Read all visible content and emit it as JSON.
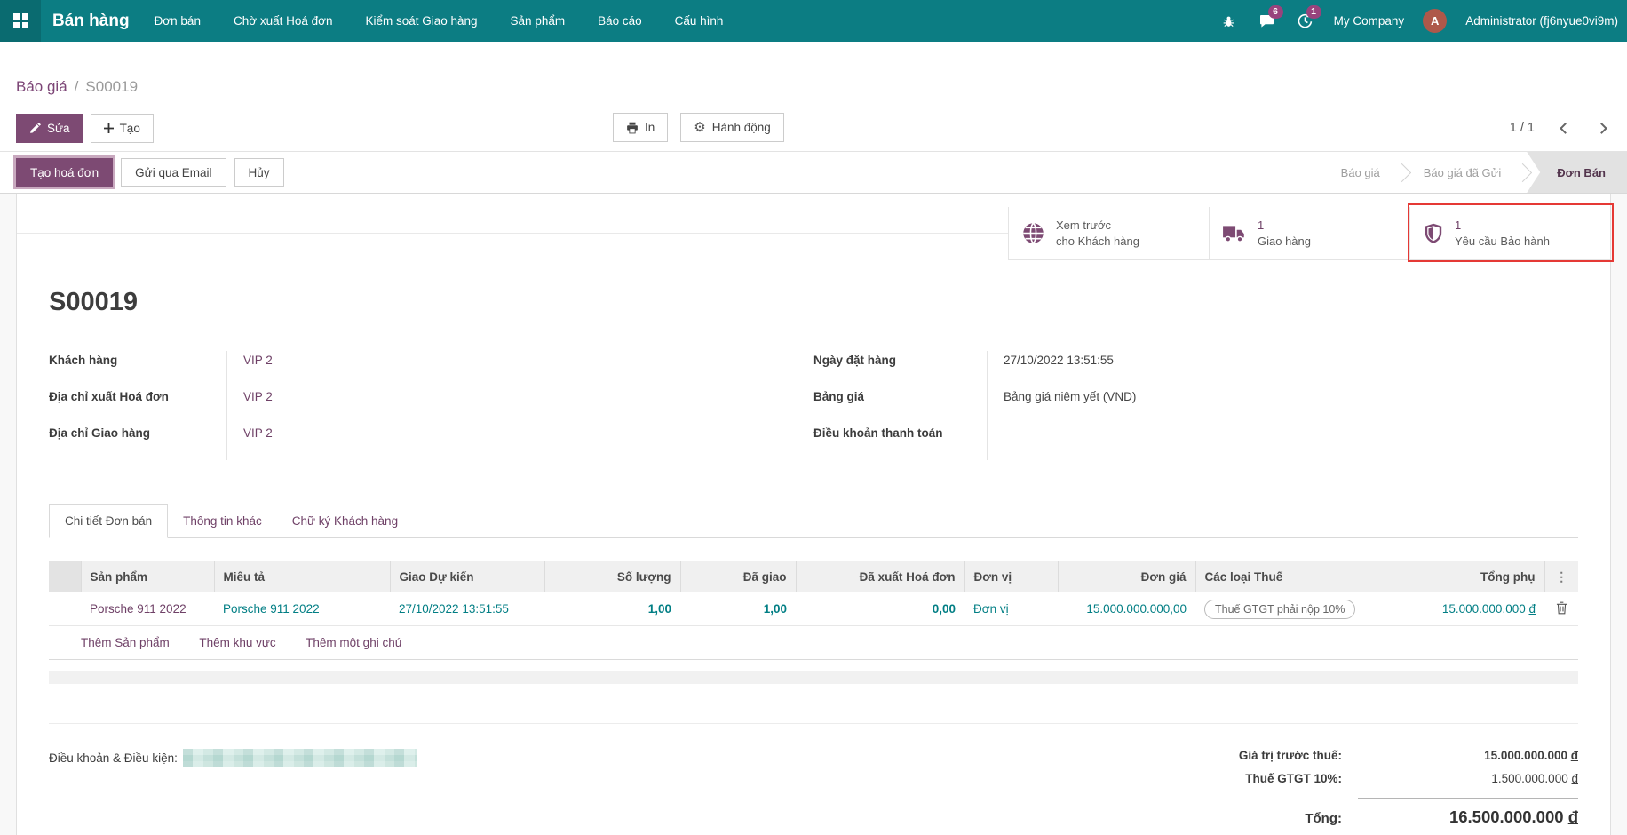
{
  "navbar": {
    "app_name": "Bán hàng",
    "menu_items": [
      "Đơn bán",
      "Chờ xuất Hoá đơn",
      "Kiểm soát Giao hàng",
      "Sản phẩm",
      "Báo cáo",
      "Cấu hình"
    ],
    "badges": {
      "messages": "6",
      "activities": "1"
    },
    "company": "My Company",
    "avatar_letter": "A",
    "user_name": "Administrator (fj6nyue0vi9m)"
  },
  "breadcrumb": {
    "parent": "Báo giá",
    "separator": "/",
    "current": "S00019"
  },
  "control_panel": {
    "edit_label": "Sửa",
    "create_label": "Tạo",
    "print_label": "In",
    "action_label": "Hành động",
    "pager_text": "1 / 1"
  },
  "statusbar": {
    "buttons": [
      "Tạo hoá đơn",
      "Gửi qua Email",
      "Hủy"
    ],
    "stages": [
      {
        "label": "Báo giá",
        "active": false
      },
      {
        "label": "Báo giá đã Gửi",
        "active": false
      },
      {
        "label": "Đơn Bán",
        "active": true
      }
    ]
  },
  "smart_buttons": {
    "preview": {
      "line1": "Xem trước",
      "line2": "cho Khách hàng"
    },
    "delivery": {
      "value": "1",
      "label": "Giao hàng"
    },
    "warranty": {
      "value": "1",
      "label": "Yêu cầu Bảo hành"
    }
  },
  "order": {
    "title": "S00019",
    "fields": {
      "customer": {
        "label": "Khách hàng",
        "value": "VIP 2"
      },
      "invoice_address": {
        "label": "Địa chỉ xuất Hoá đơn",
        "value": "VIP 2"
      },
      "delivery_address": {
        "label": "Địa chỉ Giao hàng",
        "value": "VIP 2"
      },
      "order_date": {
        "label": "Ngày đặt hàng",
        "value": "27/10/2022 13:51:55"
      },
      "pricelist": {
        "label": "Bảng giá",
        "value": "Bảng giá niêm yết (VND)"
      },
      "payment_terms": {
        "label": "Điều khoản thanh toán",
        "value": ""
      }
    }
  },
  "tabs": [
    {
      "label": "Chi tiết Đơn bán",
      "active": true
    },
    {
      "label": "Thông tin khác",
      "active": false
    },
    {
      "label": "Chữ ký Khách hàng",
      "active": false
    }
  ],
  "table": {
    "headers": [
      "Sản phẩm",
      "Miêu tả",
      "Giao Dự kiến",
      "Số lượng",
      "Đã giao",
      "Đã xuất Hoá đơn",
      "Đơn vị",
      "Đơn giá",
      "Các loại Thuế",
      "Tổng phụ"
    ],
    "row": {
      "product": "Porsche 911 2022",
      "description": "Porsche 911 2022",
      "expected_delivery": "27/10/2022 13:51:55",
      "quantity": "1,00",
      "delivered": "1,00",
      "invoiced": "0,00",
      "uom": "Đơn vị",
      "unit_price": "15.000.000.000,00",
      "taxes": "Thuế GTGT phải nộp 10%",
      "subtotal": "15.000.000.000",
      "currency": "đ"
    },
    "footer_links": [
      "Thêm Sản phẩm",
      "Thêm khu vực",
      "Thêm một ghi chú"
    ]
  },
  "terms": {
    "label": "Điều khoản & Điều kiện:"
  },
  "totals": {
    "untaxed": {
      "label": "Giá trị trước thuế:",
      "value": "15.000.000.000",
      "currency": "đ"
    },
    "tax": {
      "label": "Thuế GTGT 10%:",
      "value": "1.500.000.000",
      "currency": "đ"
    },
    "total": {
      "label": "Tổng:",
      "value": "16.500.000.000",
      "currency": "đ"
    }
  },
  "icons": {
    "gear": "⚙",
    "ellipsis_v": "⋮"
  }
}
